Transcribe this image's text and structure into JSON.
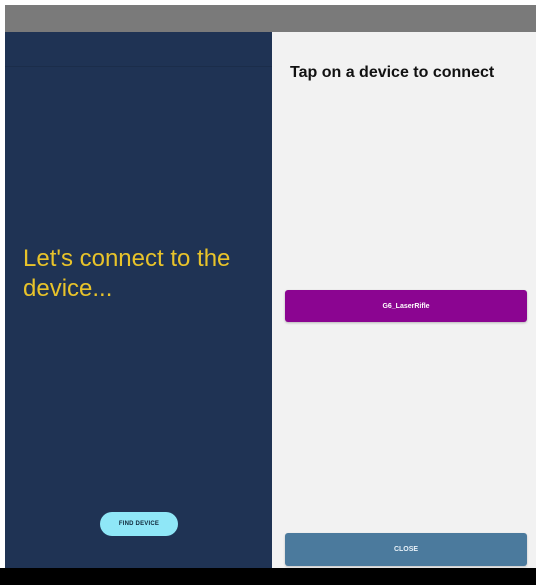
{
  "left_panel": {
    "headline": "Let's connect to the device...",
    "find_device_label": "FIND DEVICE"
  },
  "device_dialog": {
    "title": "Tap on a device to connect",
    "devices": [
      {
        "name": "G6_LaserRifle"
      }
    ],
    "close_label": "CLOSE"
  },
  "colors": {
    "left_panel_bg": "#1f3354",
    "headline_text": "#e8c32a",
    "find_device_button_bg": "#8fe7f7",
    "right_panel_bg": "#f2f2f2",
    "device_item_bg": "#8b0591",
    "close_button_bg": "#4b7a9d",
    "status_bar_bg": "#7a7a7a",
    "nav_bar_bg": "#000000"
  }
}
